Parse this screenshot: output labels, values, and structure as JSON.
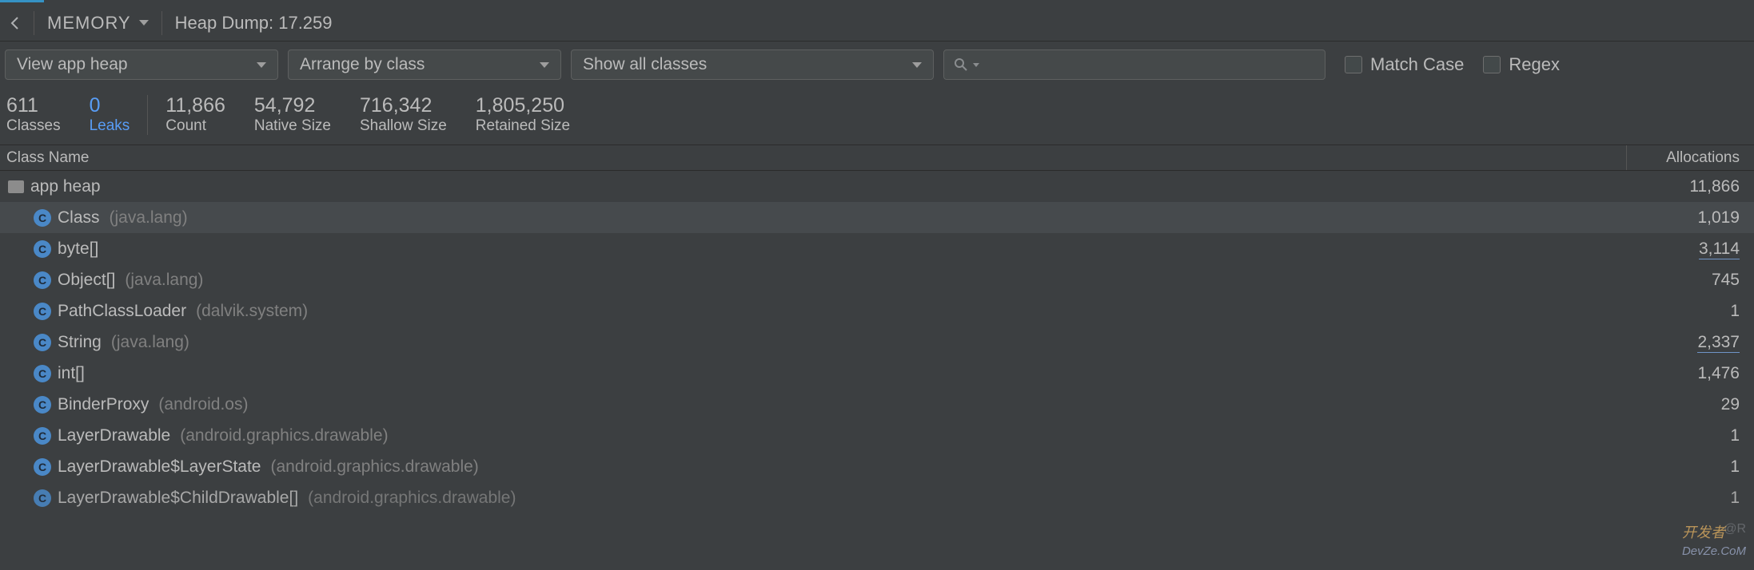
{
  "header": {
    "memory_label": "MEMORY",
    "dump_label": "Heap Dump: 17.259"
  },
  "filters": {
    "heap_dropdown": "View app heap",
    "arrange_dropdown": "Arrange by class",
    "show_dropdown": "Show all classes",
    "search_placeholder": "",
    "match_case": "Match Case",
    "regex": "Regex"
  },
  "stats": [
    {
      "value": "611",
      "label": "Classes"
    },
    {
      "value": "0",
      "label": "Leaks"
    },
    {
      "value": "11,866",
      "label": "Count"
    },
    {
      "value": "54,792",
      "label": "Native Size"
    },
    {
      "value": "716,342",
      "label": "Shallow Size"
    },
    {
      "value": "1,805,250",
      "label": "Retained Size"
    }
  ],
  "table": {
    "col_class": "Class Name",
    "col_alloc": "Allocations",
    "root": {
      "name": "app heap",
      "alloc": "11,866"
    },
    "rows": [
      {
        "name": "Class",
        "pkg": "(java.lang)",
        "alloc": "1,019"
      },
      {
        "name": "byte[]",
        "pkg": "",
        "alloc": "3,114"
      },
      {
        "name": "Object[]",
        "pkg": "(java.lang)",
        "alloc": "745"
      },
      {
        "name": "PathClassLoader",
        "pkg": "(dalvik.system)",
        "alloc": "1"
      },
      {
        "name": "String",
        "pkg": "(java.lang)",
        "alloc": "2,337"
      },
      {
        "name": "int[]",
        "pkg": "",
        "alloc": "1,476"
      },
      {
        "name": "BinderProxy",
        "pkg": "(android.os)",
        "alloc": "29"
      },
      {
        "name": "LayerDrawable",
        "pkg": "(android.graphics.drawable)",
        "alloc": "1"
      },
      {
        "name": "LayerDrawable$LayerState",
        "pkg": "(android.graphics.drawable)",
        "alloc": "1"
      },
      {
        "name": "LayerDrawable$ChildDrawable[]",
        "pkg": "(android.graphics.drawable)",
        "alloc": "1"
      }
    ]
  },
  "watermark": "开发者",
  "watermark_sub": "DevZe.CoM",
  "watermark_at": "@R"
}
